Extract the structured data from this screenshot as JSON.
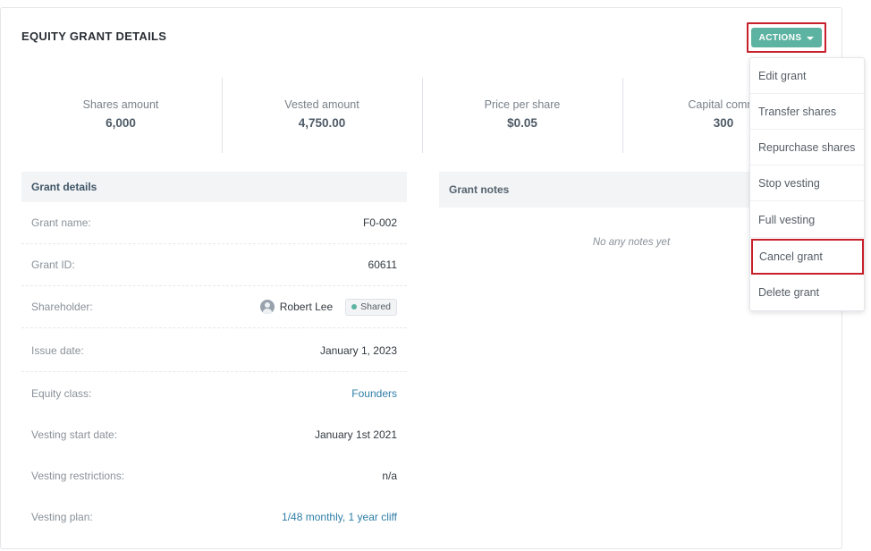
{
  "card": {
    "title": "EQUITY GRANT DETAILS"
  },
  "actions": {
    "label": "ACTIONS",
    "menu": [
      "Edit grant",
      "Transfer shares",
      "Repurchase shares",
      "Stop vesting",
      "Full vesting",
      "Cancel grant",
      "Delete grant"
    ]
  },
  "stats": [
    {
      "label": "Shares amount",
      "value": "6,000"
    },
    {
      "label": "Vested amount",
      "value": "4,750.00"
    },
    {
      "label": "Price per share",
      "value": "$0.05"
    },
    {
      "label": "Capital commi",
      "value": "300"
    }
  ],
  "grant_details": {
    "title": "Grant details",
    "rows": [
      {
        "label": "Grant name:",
        "value": "F0-002"
      },
      {
        "label": "Grant ID:",
        "value": "60611"
      },
      {
        "label": "Shareholder:",
        "value": "Robert Lee",
        "badge": "Shared"
      },
      {
        "label": "Issue date:",
        "value": "January 1, 2023"
      },
      {
        "label": "Equity class:",
        "value": "Founders"
      },
      {
        "label": "Vesting start date:",
        "value": "January 1st 2021"
      },
      {
        "label": "Vesting restrictions:",
        "value": "n/a"
      },
      {
        "label": "Vesting plan:",
        "value": "1/48 monthly, 1 year cliff"
      }
    ]
  },
  "grant_notes": {
    "title": "Grant notes",
    "empty_text": "No any notes yet"
  },
  "colors": {
    "accent": "#5db3a1",
    "link": "#2e7ea6",
    "highlight": "#c8202a"
  }
}
